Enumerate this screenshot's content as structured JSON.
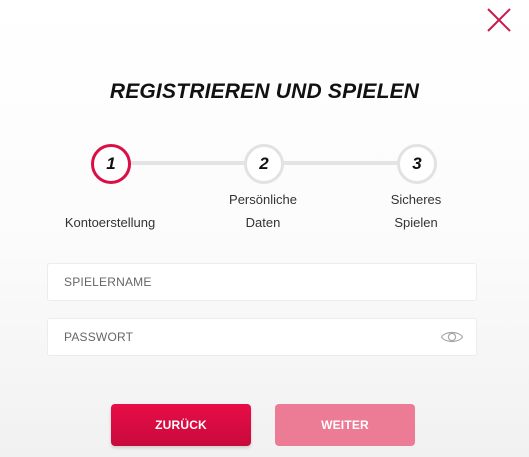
{
  "modal": {
    "title": "REGISTRIEREN UND SPIELEN"
  },
  "stepper": {
    "steps": [
      {
        "number": "1",
        "label": "Kontoerstellung",
        "label_line2": "",
        "active": true
      },
      {
        "number": "2",
        "label": "Persönliche",
        "label_line2": "Daten",
        "active": false
      },
      {
        "number": "3",
        "label": "Sicheres",
        "label_line2": "Spielen",
        "active": false
      }
    ]
  },
  "form": {
    "username": {
      "placeholder": "SPIELERNAME",
      "value": ""
    },
    "password": {
      "placeholder": "PASSWORT",
      "value": ""
    }
  },
  "buttons": {
    "back_label": "ZURÜCK",
    "next_label": "WEITER"
  },
  "colors": {
    "accent": "#d90f45",
    "next_disabled": "#ec7b96",
    "close_icon": "#c9194a"
  },
  "icons": {
    "close": "close-icon",
    "password_toggle": "eye-icon"
  }
}
